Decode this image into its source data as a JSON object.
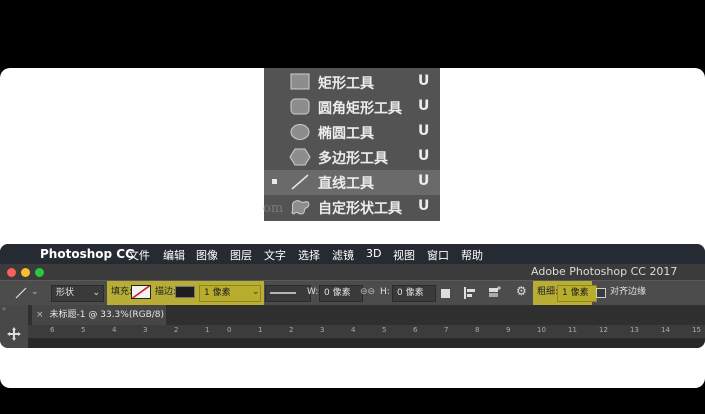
{
  "flyout": {
    "items": [
      {
        "icon": "rectangle-tool-icon",
        "label": "矩形工具",
        "key": "U",
        "selected": false
      },
      {
        "icon": "rounded-rectangle-tool-icon",
        "label": "圆角矩形工具",
        "key": "U",
        "selected": false
      },
      {
        "icon": "ellipse-tool-icon",
        "label": "椭圆工具",
        "key": "U",
        "selected": false
      },
      {
        "icon": "polygon-tool-icon",
        "label": "多边形工具",
        "key": "U",
        "selected": false
      },
      {
        "icon": "line-tool-icon",
        "label": "直线工具",
        "key": "U",
        "selected": true
      },
      {
        "icon": "custom-shape-tool-icon",
        "label": "自定形状工具",
        "key": "U",
        "selected": false
      }
    ],
    "watermark": "om"
  },
  "menubar": {
    "app_name": "Photoshop CC",
    "menus": [
      "文件",
      "编辑",
      "图像",
      "图层",
      "文字",
      "选择",
      "滤镜",
      "3D",
      "视图",
      "窗口",
      "帮助"
    ]
  },
  "window": {
    "title": "Adobe Photoshop CC 2017"
  },
  "options": {
    "mode": "形状",
    "fill_label": "填充:",
    "stroke_label": "描边:",
    "stroke_width": "1 像素",
    "w_label": "W:",
    "w_value": "0 像素",
    "link_glyph": "⊖⊖",
    "h_label": "H:",
    "h_value": "0 像素",
    "weight_label": "粗细:",
    "weight_value": "1 像素",
    "align_edges": "对齐边缘"
  },
  "tab": {
    "close": "×",
    "label": "未标题-1 @ 33.3%(RGB/8)"
  },
  "ruler": {
    "ticks": [
      "6",
      "5",
      "4",
      "3",
      "2",
      "1",
      "0",
      "1",
      "2",
      "3",
      "4",
      "5",
      "6",
      "7",
      "8",
      "9",
      "10",
      "11",
      "12",
      "13",
      "14",
      "15"
    ]
  },
  "colors": {
    "highlight": "#cbbf32",
    "menubar": "#262b33",
    "flyout_bg": "#535353"
  }
}
